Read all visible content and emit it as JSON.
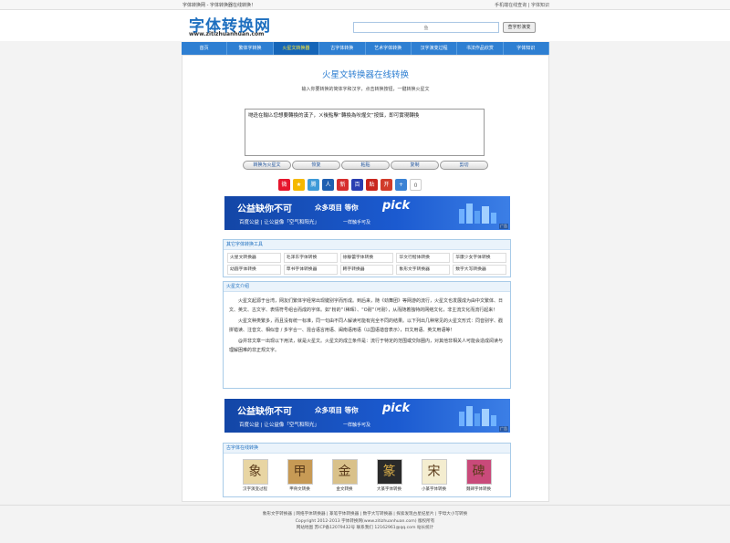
{
  "topbar": {
    "left_text": "字体转换网 - 字体转换器在线转换！",
    "right_text": "手机端在线查询 | 字体知识"
  },
  "header": {
    "logo": "字体转换网",
    "logo_url": "www.zitizhuanhuan.com",
    "search_value": "鱼",
    "search_button": "查字形演变"
  },
  "nav": {
    "items": [
      "首页",
      "繁体字转换",
      "火星文转换器",
      "古字体转换",
      "艺术字体转换",
      "汉字演变过程",
      "书法作品欣赏",
      "字体知识"
    ],
    "active_index": 2
  },
  "main": {
    "title": "火星文转换器在线转换",
    "subtitle": "输入你要转换的简体字和汉字，点击转换按钮，一键转换火星文",
    "textarea_value": "哋迯在輸兦您想要轉換的漢孒，ㄨ後點擊“轉換為吙煋攵”按鈕，即可實現轉換",
    "buttons": [
      "转换为火星文",
      "恢复",
      "粘贴",
      "复制",
      "剪切"
    ]
  },
  "share_icons": [
    {
      "name": "weibo-icon",
      "glyph": "微",
      "color": "#e6162d"
    },
    {
      "name": "qzone-icon",
      "glyph": "★",
      "color": "#f5b800"
    },
    {
      "name": "tencent-weibo-icon",
      "glyph": "腾",
      "color": "#3d9ad8"
    },
    {
      "name": "renren-icon",
      "glyph": "人",
      "color": "#1f5fb0"
    },
    {
      "name": "sina-icon",
      "glyph": "新",
      "color": "#d62d2d"
    },
    {
      "name": "baidu-icon",
      "glyph": "百",
      "color": "#2a3eb1"
    },
    {
      "name": "tieba-icon",
      "glyph": "贴",
      "color": "#c9261e"
    },
    {
      "name": "kaixin-icon",
      "glyph": "开",
      "color": "#d13b2a"
    },
    {
      "name": "plus-icon",
      "glyph": "+",
      "color": "#3a82d4"
    },
    {
      "name": "count-icon",
      "glyph": "0",
      "color": "#cccccc"
    }
  ],
  "ad": {
    "headline": "公益缺你不可",
    "middle": "众多项目 等你",
    "brand": "pick",
    "bottom": "百度公益 | 让公益像「空气和阳光」",
    "slogan": "一样触手可及",
    "tag": "广告"
  },
  "tools": {
    "heading": "其它字体转换工具",
    "items": [
      "火星文转换器",
      "毛泽东字体转换",
      "徐静蕾字体转换",
      "华文行楷体转换",
      "华康少女字体转换",
      "幼圆字体转换",
      "草书字体转换器",
      "韩字转换器",
      "象形文字转换器",
      "数字大写转换器"
    ]
  },
  "intro": {
    "heading": "火星文介绍",
    "paragraphs": [
      "火星文起源于台湾，网友们繁体字经常出现键别字而形成。到后来，随《劲舞团》等网游的流行，火星文也发展成为由中文繁体、日文、英文、古文字、表情符号组合而成的字体。如“粉的”（稀晖）、“O耐”（可耐），从而随着独特的网络文化，非主流文化而流行起来！",
      "火星文种类繁多，而且没有统一标准，同一句由不同人解读可能有完全不同的结果。以下列出几种常见的火星文形式：同音别字、戳拼错读、注音文、相似音 / 多字合一、混合语言用语、闽南语用语（以国语谐音表示），日文用语、英文用语等！",
      "@并非文章一出现以下用法，就是火星文。火星文的成立条件是：流行于特定的范围或交际圈内，对其他非相关人可能会造成阅读与理解困难的非正规文字。"
    ]
  },
  "gallery": {
    "heading": "古字体在线转换",
    "items": [
      {
        "label": "汉字演变过程",
        "glyph": "象",
        "bg": "#e8d5a3"
      },
      {
        "label": "甲骨文转换",
        "glyph": "甲",
        "bg": "#c79a55"
      },
      {
        "label": "金文转换",
        "glyph": "金",
        "bg": "#d9c18a"
      },
      {
        "label": "大篆字体转换",
        "glyph": "篆",
        "bg": "#2a2a2a"
      },
      {
        "label": "小篆字体转换",
        "glyph": "宋",
        "bg": "#f4edd0"
      },
      {
        "label": "魏碑字体转换",
        "glyph": "碑",
        "bg": "#c94a7a"
      }
    ]
  },
  "footer": {
    "lines": [
      "象形文字转换器 | 网络字体转换器 | 篆笔字体转换器 | 数字大写转换器 | 探索发现古星纪星片 | 字母大小写转换",
      "Copyright 2012-2013 字体转换网(www.zitizhuanhuan.com) 版权所有",
      "网站地图 苏ICP备12079432号 联系我们 12162961@qq.com 站长统计"
    ]
  }
}
